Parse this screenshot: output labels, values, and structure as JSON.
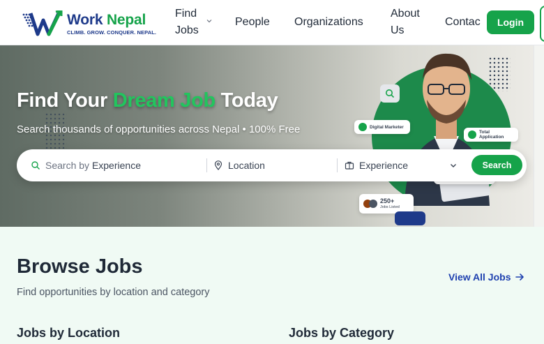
{
  "brand": {
    "name_part1": "Work",
    "name_part2": "Nepal",
    "tagline": "CLIMB. GROW. CONQUER. NEPAL."
  },
  "nav": {
    "find_jobs": "Find Jobs",
    "people": "People",
    "organizations": "Organizations",
    "about_us": "About Us",
    "contact": "Contac",
    "login": "Login"
  },
  "hero": {
    "title_part1": "Find Your",
    "title_highlight": "Dream Job",
    "title_part2": "Today",
    "subtitle": "Search thousands of opportunities across Nepal • 100% Free",
    "cards": {
      "digital_marketer": "Digital Marketer",
      "total_application": "Total Application",
      "jobs_count": "250+",
      "jobs_label": "Jobs Listed"
    }
  },
  "search": {
    "keyword_prefix": "Search by",
    "keyword_value": "Experience",
    "location_placeholder": "Location",
    "experience_value": "Experience",
    "button": "Search"
  },
  "browse": {
    "title": "Browse Jobs",
    "subtitle": "Find opportunities by location and category",
    "view_all": "View All Jobs",
    "by_location": "Jobs by Location",
    "by_category": "Jobs by Category"
  },
  "colors": {
    "brand_green": "#16a34a",
    "brand_blue": "#1e3a8a",
    "link_blue": "#1e40af",
    "section_bg": "#f0faf4"
  },
  "icons": {
    "nav_dropdown": "chevron-down-icon",
    "keyword": "search-icon",
    "location": "map-pin-icon",
    "experience": "briefcase-icon",
    "experience_dropdown": "chevron-down-icon",
    "view_all": "arrow-right-icon"
  }
}
